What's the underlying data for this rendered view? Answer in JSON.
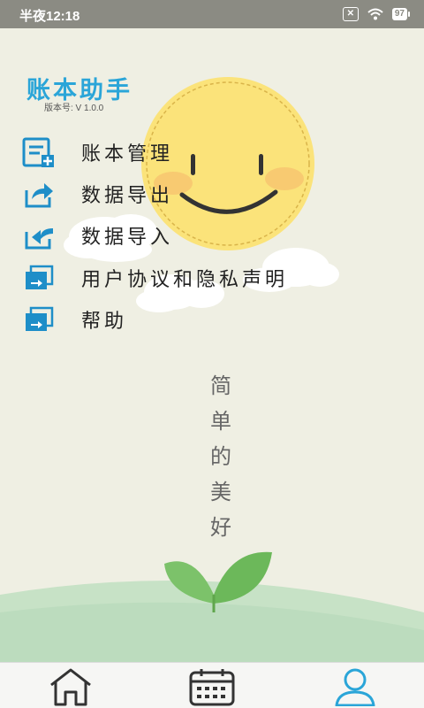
{
  "status_bar": {
    "time": "半夜12:18",
    "sim_glyph": "✕",
    "battery": "97"
  },
  "app": {
    "title": "账本助手",
    "version": "版本号: V 1.0.0"
  },
  "menu": [
    {
      "label": "账本管理",
      "icon": "ledger-add-icon"
    },
    {
      "label": "数据导出",
      "icon": "export-arrow-icon"
    },
    {
      "label": "数据导入",
      "icon": "import-arrow-icon"
    },
    {
      "label": "用户协议和隐私声明",
      "icon": "document-share-icon"
    },
    {
      "label": "帮助",
      "icon": "help-document-icon"
    }
  ],
  "slogan": [
    "简",
    "单",
    "的",
    "美",
    "好"
  ],
  "tabs": [
    {
      "name": "home",
      "icon": "home-icon"
    },
    {
      "name": "calendar",
      "icon": "calendar-icon"
    },
    {
      "name": "profile",
      "icon": "user-icon",
      "active": true
    }
  ],
  "colors": {
    "accent": "#2aa5d8",
    "icon_blue": "#1e8ec8",
    "status_bar": "#8b8b83"
  }
}
